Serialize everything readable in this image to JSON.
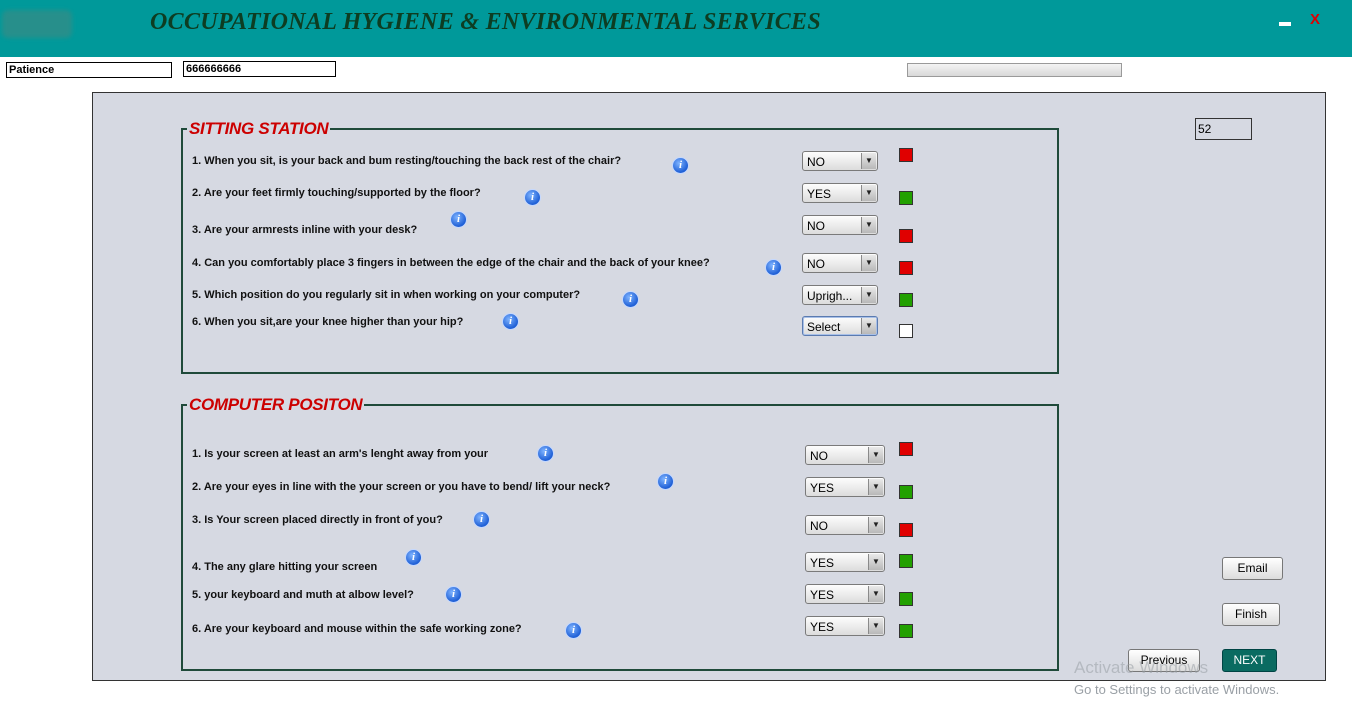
{
  "header": {
    "title": "OCCUPATIONAL HYGIENE & ENVIRONMENTAL SERVICES",
    "minimize_label": "",
    "close_label": "X"
  },
  "user": {
    "name": "Patience",
    "id": "666666666"
  },
  "counter": "52",
  "sections": [
    {
      "title": "SITTING STATION",
      "questions": [
        {
          "text": "1.  When you sit, is your back and bum resting/touching the back rest of the chair?",
          "answer": "NO",
          "status": "#e00000"
        },
        {
          "text": "2.  Are your feet firmly touching/supported by the floor?",
          "answer": "YES",
          "status": "#22a000"
        },
        {
          "text": "3.  Are your armrests inline with your desk?",
          "answer": "NO",
          "status": "#e00000"
        },
        {
          "text": "4.   Can  you comfortably place 3 fingers in between the edge of the chair and the back of your knee?",
          "answer": "NO",
          "status": "#e00000"
        },
        {
          "text": "5.   Which position do you regularly sit in when working on your computer?",
          "answer": "Uprigh...",
          "status": "#22a000"
        },
        {
          "text": "6.    When you sit,are  your knee higher than your hip?",
          "answer": "Select",
          "status": "#ffffff"
        }
      ]
    },
    {
      "title": "COMPUTER POSITON",
      "questions": [
        {
          "text": "1.   Is your screen at least an arm's lenght away from your",
          "answer": "NO",
          "status": "#e00000"
        },
        {
          "text": "2.   Are your eyes in line with the your screen or you have to bend/ lift your neck?",
          "answer": "YES",
          "status": "#22a000"
        },
        {
          "text": "3.   Is Your screen placed directly in front of you?",
          "answer": "NO",
          "status": "#e00000"
        },
        {
          "text": "4.   The any glare hitting your screen",
          "answer": "YES",
          "status": "#22a000"
        },
        {
          "text": "5.   your keyboard and muth at albow level?",
          "answer": "YES",
          "status": "#22a000"
        },
        {
          "text": "6.   Are your keyboard and mouse within the safe working zone?",
          "answer": "YES",
          "status": "#22a000"
        }
      ]
    }
  ],
  "buttons": {
    "email": "Email",
    "finish": "Finish",
    "previous": "Previous",
    "next": "NEXT"
  },
  "info_glyph": "i",
  "dropdown_arrow": "▼",
  "watermark": {
    "line1": "Activate Windows",
    "line2": "Go to Settings to activate Windows."
  }
}
